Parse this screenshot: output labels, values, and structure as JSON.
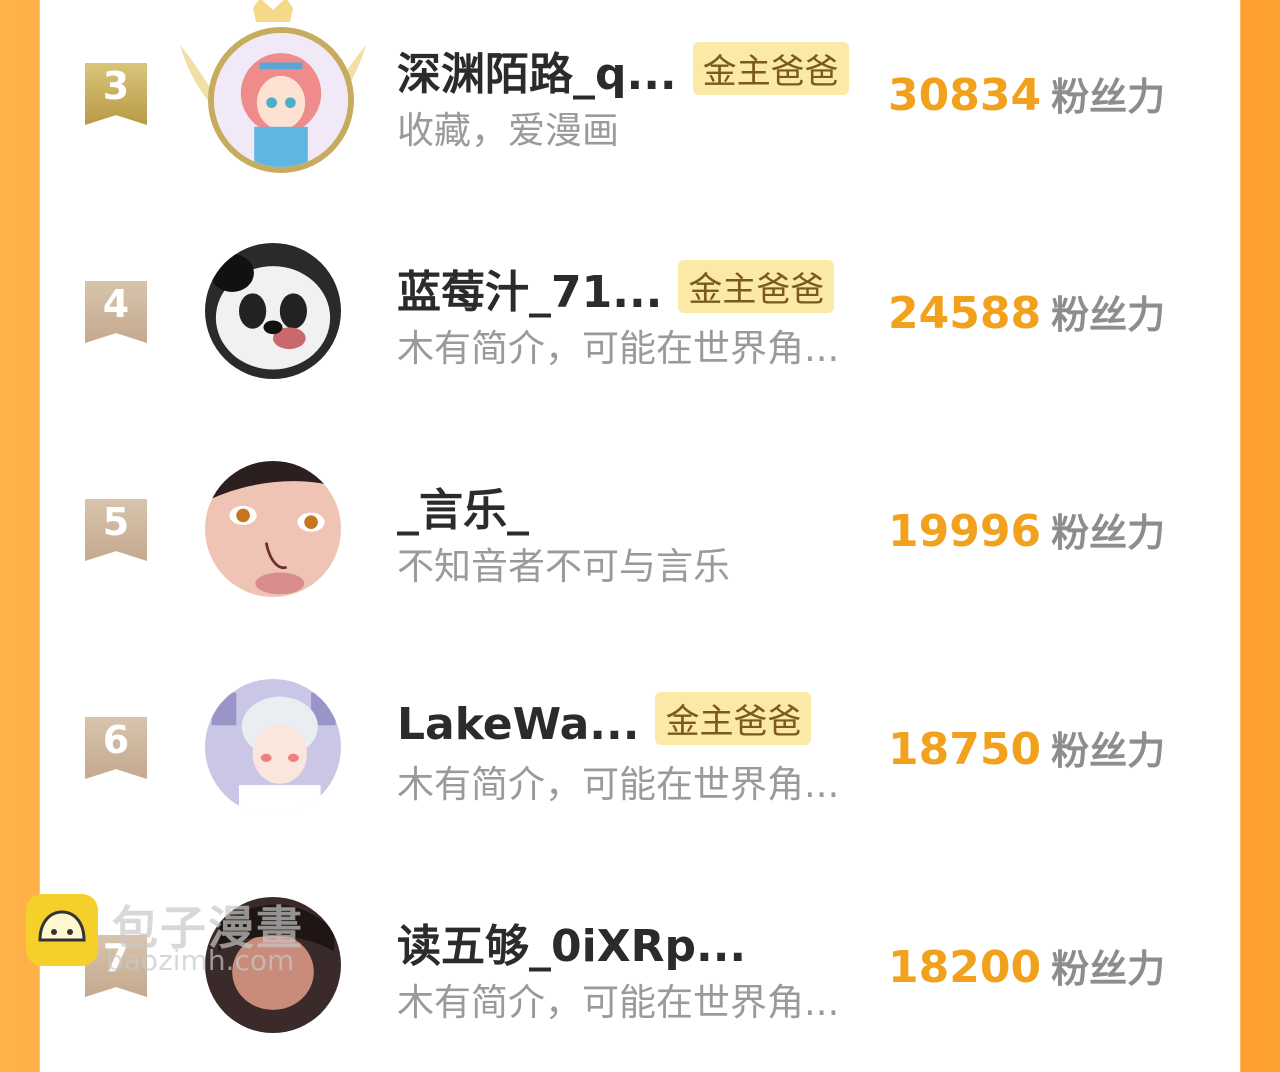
{
  "rows": [
    {
      "rank": "3",
      "name": "深渊陌路_q...",
      "badge": "金主爸爸",
      "bio": "收藏，爱漫画",
      "score": "30834",
      "unit": "粉丝力"
    },
    {
      "rank": "4",
      "name": "蓝莓汁_71...",
      "badge": "金主爸爸",
      "bio": "木有简介，可能在世界角...",
      "score": "24588",
      "unit": "粉丝力"
    },
    {
      "rank": "5",
      "name": "_言乐_",
      "badge": "",
      "bio": "不知音者不可与言乐",
      "score": "19996",
      "unit": "粉丝力"
    },
    {
      "rank": "6",
      "name": "LakeWa...",
      "badge": "金主爸爸",
      "bio": "木有简介，可能在世界角...",
      "score": "18750",
      "unit": "粉丝力"
    },
    {
      "rank": "7",
      "name": "读五够_0iXRp...",
      "badge": "",
      "bio": "木有简介，可能在世界角...",
      "score": "18200",
      "unit": "粉丝力"
    }
  ],
  "watermark": {
    "title": "包子漫畫",
    "subtitle": "baozimh.com"
  },
  "colors": {
    "accent": "#f2a11d",
    "badge_bg": "#fbe9a8",
    "frame": "#ffa233"
  }
}
